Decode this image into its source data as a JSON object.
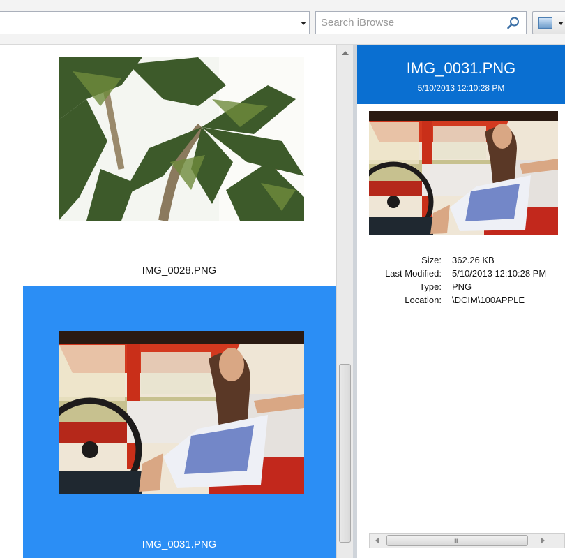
{
  "toolbar": {
    "path_value": "",
    "search_placeholder": "Search iBrowse"
  },
  "files": [
    {
      "name": "IMG_0028.PNG",
      "image": "palm-trees-photo",
      "selected": false
    },
    {
      "name": "IMG_0031.PNG",
      "image": "woman-in-red-truck-photo",
      "selected": true
    }
  ],
  "details": {
    "title": "IMG_0031.PNG",
    "date": "5/10/2013 12:10:28 PM",
    "properties": [
      {
        "key": "Size:",
        "value": "362.26 KB"
      },
      {
        "key": "Last Modified:",
        "value": "5/10/2013 12:10:28 PM"
      },
      {
        "key": "Type:",
        "value": "PNG"
      },
      {
        "key": "Location:",
        "value": "\\DCIM\\100APPLE"
      }
    ]
  },
  "colors": {
    "selection": "#2b8ef5",
    "header": "#0a6fd1"
  },
  "icons": {
    "search": "magnifier-icon",
    "view": "picture-view-icon"
  },
  "glyphs": {
    "grip": "III"
  }
}
